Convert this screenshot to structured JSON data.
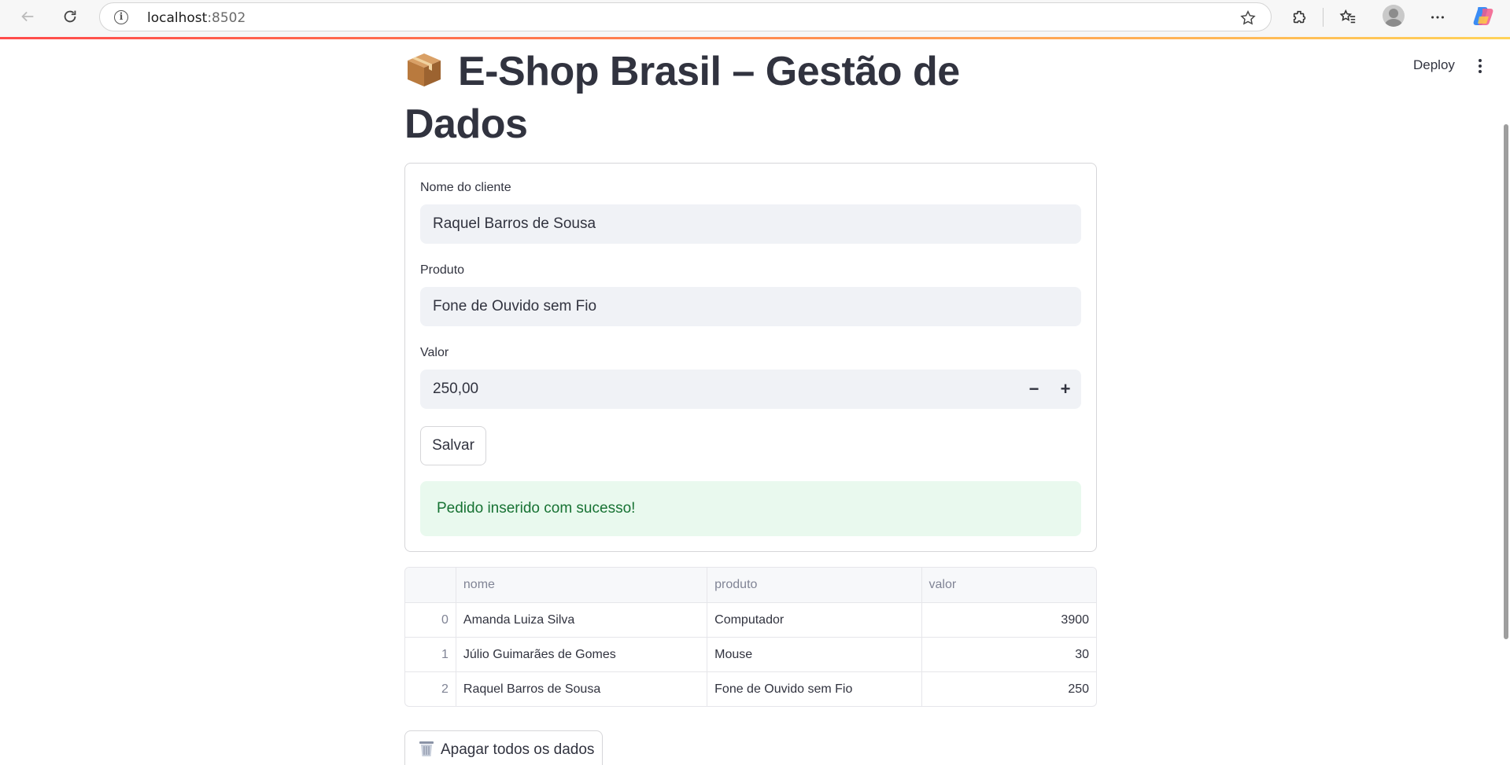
{
  "browser": {
    "url_host": "localhost",
    "url_port": ":8502"
  },
  "header": {
    "deploy_label": "Deploy"
  },
  "page": {
    "title": "E-Shop Brasil – Gestão de Dados",
    "title_icon": "package-icon"
  },
  "form": {
    "nome_label": "Nome do cliente",
    "nome_value": "Raquel Barros de Sousa",
    "produto_label": "Produto",
    "produto_value": "Fone de Ouvido sem Fio",
    "valor_label": "Valor",
    "valor_value": "250,00",
    "minus_label": "−",
    "plus_label": "+",
    "save_label": "Salvar",
    "success_message": "Pedido inserido com sucesso!"
  },
  "table": {
    "columns": [
      "",
      "nome",
      "produto",
      "valor"
    ],
    "rows": [
      {
        "index": "0",
        "nome": "Amanda Luiza Silva",
        "produto": "Computador",
        "valor": "3900"
      },
      {
        "index": "1",
        "nome": "Júlio Guimarães de Gomes",
        "produto": "Mouse",
        "valor": "30"
      },
      {
        "index": "2",
        "nome": "Raquel Barros de Sousa",
        "produto": "Fone de Ouvido sem Fio",
        "valor": "250"
      }
    ]
  },
  "actions": {
    "clear_label": "Apagar todos os dados"
  },
  "colors": {
    "success_bg": "#e9f9ee",
    "success_text": "#177233",
    "input_bg": "#f0f2f6",
    "accent_red": "#ff4b4b"
  }
}
